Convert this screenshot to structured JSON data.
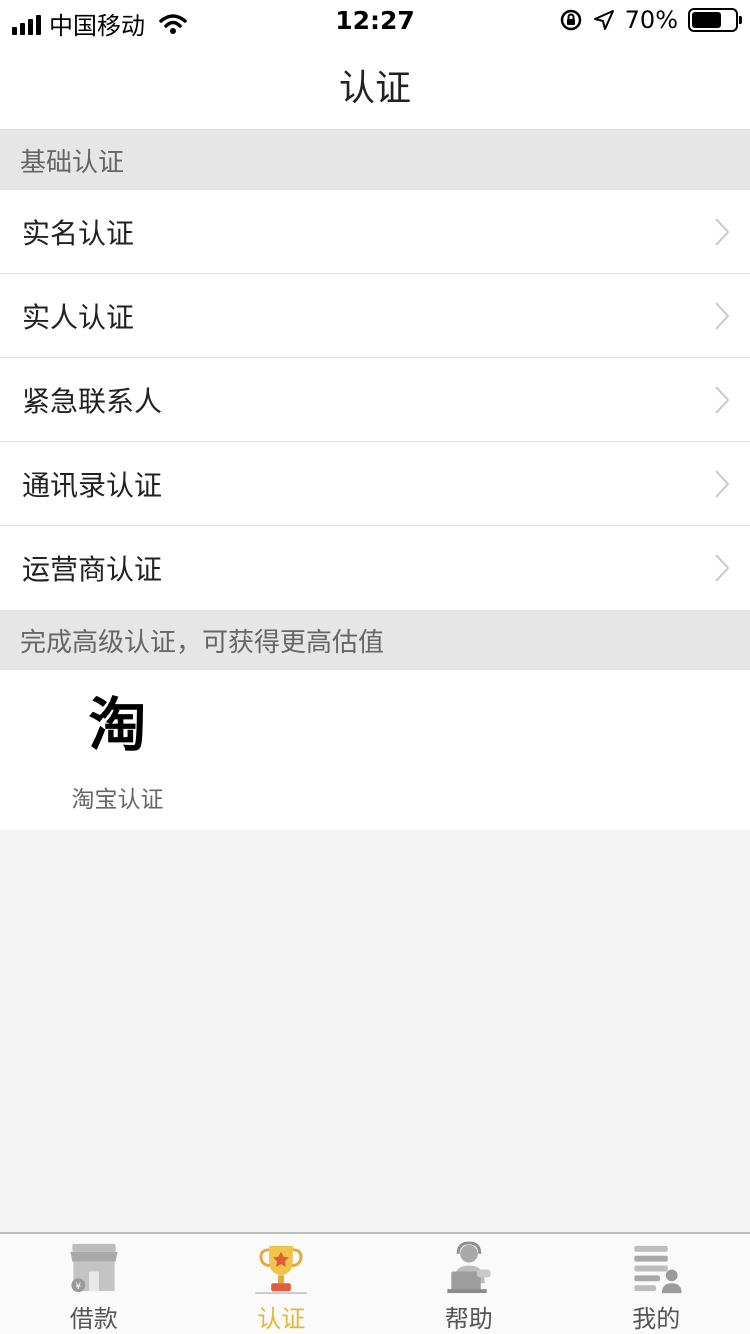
{
  "status_bar": {
    "carrier": "中国移动",
    "time": "12:27",
    "battery": "70%",
    "battery_level": 0.7
  },
  "nav": {
    "title": "认证"
  },
  "basic_section": {
    "header": "基础认证",
    "items": [
      {
        "label": "实名认证"
      },
      {
        "label": "实人认证"
      },
      {
        "label": "紧急联系人"
      },
      {
        "label": "通讯录认证"
      },
      {
        "label": "运营商认证"
      }
    ]
  },
  "advanced_section": {
    "header": "完成高级认证，可获得更高估值",
    "taobao": {
      "logo_text": "淘",
      "label": "淘宝认证"
    }
  },
  "tab_bar": {
    "accent_color": "#e5b53c",
    "tabs": [
      {
        "label": "借款",
        "icon": "shop-icon"
      },
      {
        "label": "认证",
        "icon": "trophy-icon",
        "active": true
      },
      {
        "label": "帮助",
        "icon": "customer-service-icon"
      },
      {
        "label": "我的",
        "icon": "profile-list-icon"
      }
    ]
  }
}
